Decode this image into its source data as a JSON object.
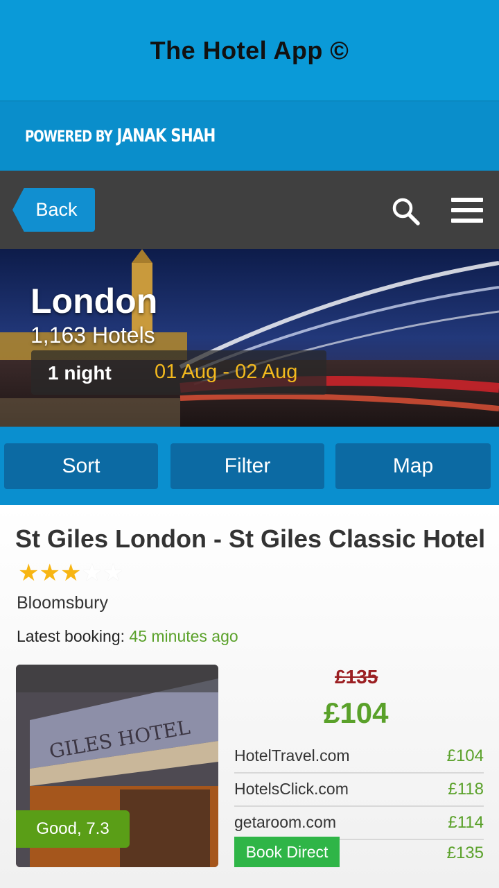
{
  "header": {
    "title": "The Hotel App ©"
  },
  "powered": {
    "prefix": "POWERED BY",
    "name": "JANAK SHAH"
  },
  "toolbar": {
    "back_label": "Back",
    "search_icon": "search-icon",
    "menu_icon": "menu-icon"
  },
  "hero": {
    "city": "London",
    "count": "1,163 Hotels",
    "nights": "1 night",
    "dates": "01 Aug - 02 Aug"
  },
  "actions": {
    "sort": "Sort",
    "filter": "Filter",
    "map": "Map"
  },
  "hotel": {
    "name": "St Giles London - St Giles Classic Hotel",
    "stars": 3,
    "stars_max": 5,
    "area": "Bloomsbury",
    "latest_label": "Latest booking:",
    "latest_value": "45 minutes ago",
    "rating": "Good, 7.3",
    "old_price": "£135",
    "new_price": "£104",
    "providers": [
      {
        "name": "HotelTravel.com",
        "price": "£104"
      },
      {
        "name": "HotelsClick.com",
        "price": "£118"
      },
      {
        "name": "getaroom.com",
        "price": "£114"
      },
      {
        "name": "Book Direct",
        "price": "£135"
      }
    ]
  },
  "colors": {
    "header": "#0a9ad8",
    "toolbar": "#404040",
    "accent_green": "#5aa12a",
    "old_price_red": "#9b1f22",
    "date_yellow": "#f3b91e",
    "star": "#f7b512"
  }
}
